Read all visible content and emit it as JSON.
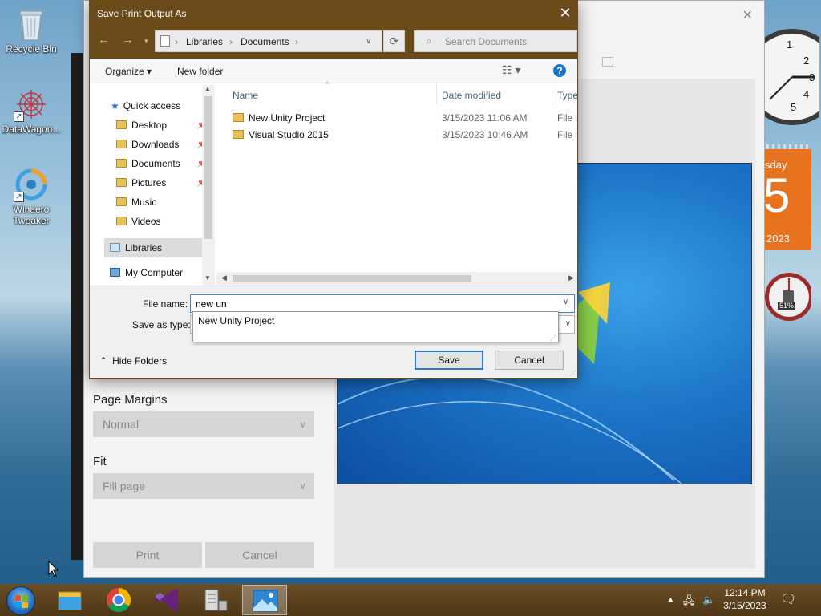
{
  "desktop": {
    "icons": [
      {
        "label": "Recycle Bin"
      },
      {
        "label": "DataWagon..."
      },
      {
        "label": "Winaero Tweaker"
      }
    ]
  },
  "gadgets": {
    "calendar": {
      "weekday_fragment": "sday",
      "day": "5",
      "year": "2023"
    },
    "meter": {
      "percent": "51%"
    }
  },
  "print_window": {
    "close_glyph": "✕",
    "page_margins_label": "Page Margins",
    "page_margins_value": "Normal",
    "fit_label": "Fit",
    "fit_value": "Fill page",
    "print_label": "Print",
    "cancel_label": "Cancel"
  },
  "dialog": {
    "title": "Save Print Output As",
    "close_glyph": "✕",
    "address": {
      "crumbs": [
        "Libraries",
        "Documents"
      ]
    },
    "search_placeholder": "Search Documents",
    "toolbar": {
      "organize": "Organize ▾",
      "new_folder": "New folder"
    },
    "nav": [
      {
        "label": "Quick access"
      },
      {
        "label": "Desktop"
      },
      {
        "label": "Downloads"
      },
      {
        "label": "Documents"
      },
      {
        "label": "Pictures"
      },
      {
        "label": "Music"
      },
      {
        "label": "Videos"
      },
      {
        "label": "Libraries"
      },
      {
        "label": "My Computer"
      }
    ],
    "columns": {
      "name": "Name",
      "date": "Date modified",
      "type": "Type"
    },
    "files": [
      {
        "name": "New Unity Project",
        "date": "3/15/2023 11:06 AM",
        "type": "File fo"
      },
      {
        "name": "Visual Studio 2015",
        "date": "3/15/2023 10:46 AM",
        "type": "File fo"
      }
    ],
    "file_name_label": "File name:",
    "file_name_value": "new un",
    "save_as_type_label": "Save as type:",
    "autocomplete_option": "New Unity Project",
    "save_label": "Save",
    "cancel_label": "Cancel",
    "hide_folders_label": "Hide Folders"
  },
  "taskbar": {
    "time": "12:14 PM",
    "date": "3/15/2023"
  },
  "colors": {
    "titlebar": "#6b4a1a",
    "taskbar": "#5a4020",
    "accent": "#2f7ad1"
  }
}
